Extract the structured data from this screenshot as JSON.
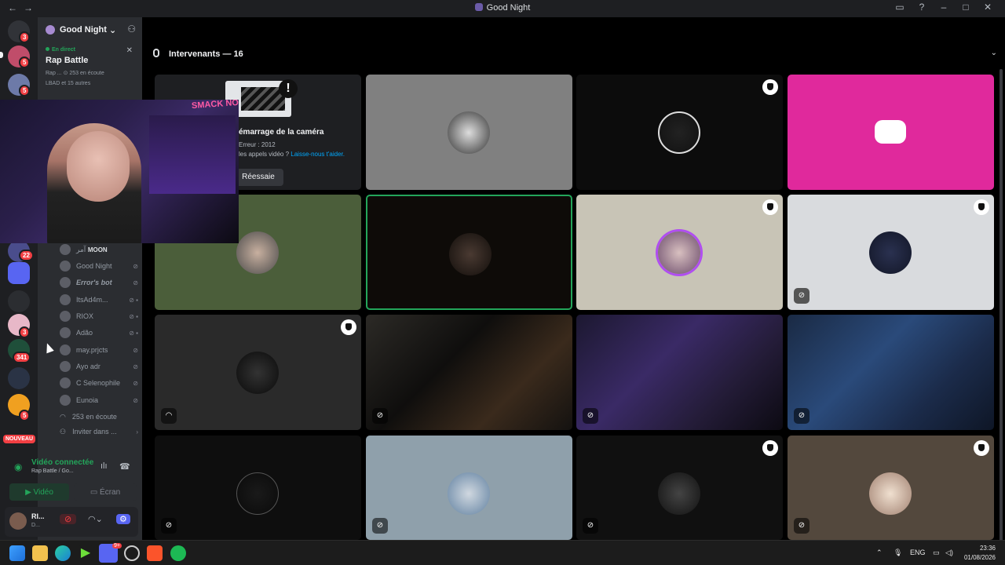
{
  "window": {
    "title": "Good Night",
    "nav": "←→"
  },
  "rail": {
    "badges": [
      "3",
      "5",
      "5",
      "22",
      "3",
      "341",
      "5"
    ],
    "new_label": "NOUVEAU"
  },
  "sidebar": {
    "server_name": "Good Night",
    "server_chevron": "⌄",
    "live": {
      "label": "En direct",
      "event_name": "Rap Battle",
      "listeners": "Rap ...   ⊙ 253 en écoute",
      "participants": "LBAD et 15 autres"
    },
    "members": [
      {
        "name": "MOON",
        "prefix": "آمر",
        "icons": ""
      },
      {
        "name": "Good Night",
        "icons": "⊘"
      },
      {
        "name": "Error's bot",
        "icons": "⊘"
      },
      {
        "name": "ItsAd4m...",
        "icons": "⊘ ▪"
      },
      {
        "name": "RIOX",
        "icons": "⊘ ▪"
      },
      {
        "name": "Adão",
        "icons": "⊘ ▪"
      },
      {
        "name": "may.prjcts",
        "icons": "⊘"
      },
      {
        "name": "Ayo adr",
        "icons": "⊘"
      },
      {
        "name": "C Selenophile",
        "icons": "⊘"
      },
      {
        "name": "Eunoia",
        "icons": "⊘"
      }
    ],
    "listeners_count": "253 en écoute",
    "invite": "Inviter dans ..."
  },
  "voice_panel": {
    "status": "Vidéo connectée",
    "channel": "Rap Battle / Go...",
    "video_button": "Vidéo",
    "screen_button": "Écran"
  },
  "user": {
    "name": "RI...",
    "status": "D..."
  },
  "main": {
    "speakers_label": "Intervenants — 16",
    "camera_error": {
      "title": "émarrage de la caméra",
      "code": "Erreur : 2012",
      "help_prefix": "les appels vidéo ?",
      "help_link": "Laisse-nous t'aider.",
      "retry": "Réessaie"
    },
    "pip_neon": "SMACK NO"
  },
  "tile_colors": [
    "#808080",
    "#0c0c0c",
    "#e0299c",
    "#4b5e3a",
    "#0e0b08",
    "#c8c4b6",
    "#d9dbde",
    "#2a2a2a",
    "#151312",
    "#241c38",
    "#1b2b4a",
    "#0e0e0e",
    "#8fa0ab",
    "#101010",
    "#53483d"
  ],
  "taskbar": {
    "lang": "ENG",
    "time": "23:36",
    "date": "01/08/2026",
    "discord_badge": "9+"
  }
}
